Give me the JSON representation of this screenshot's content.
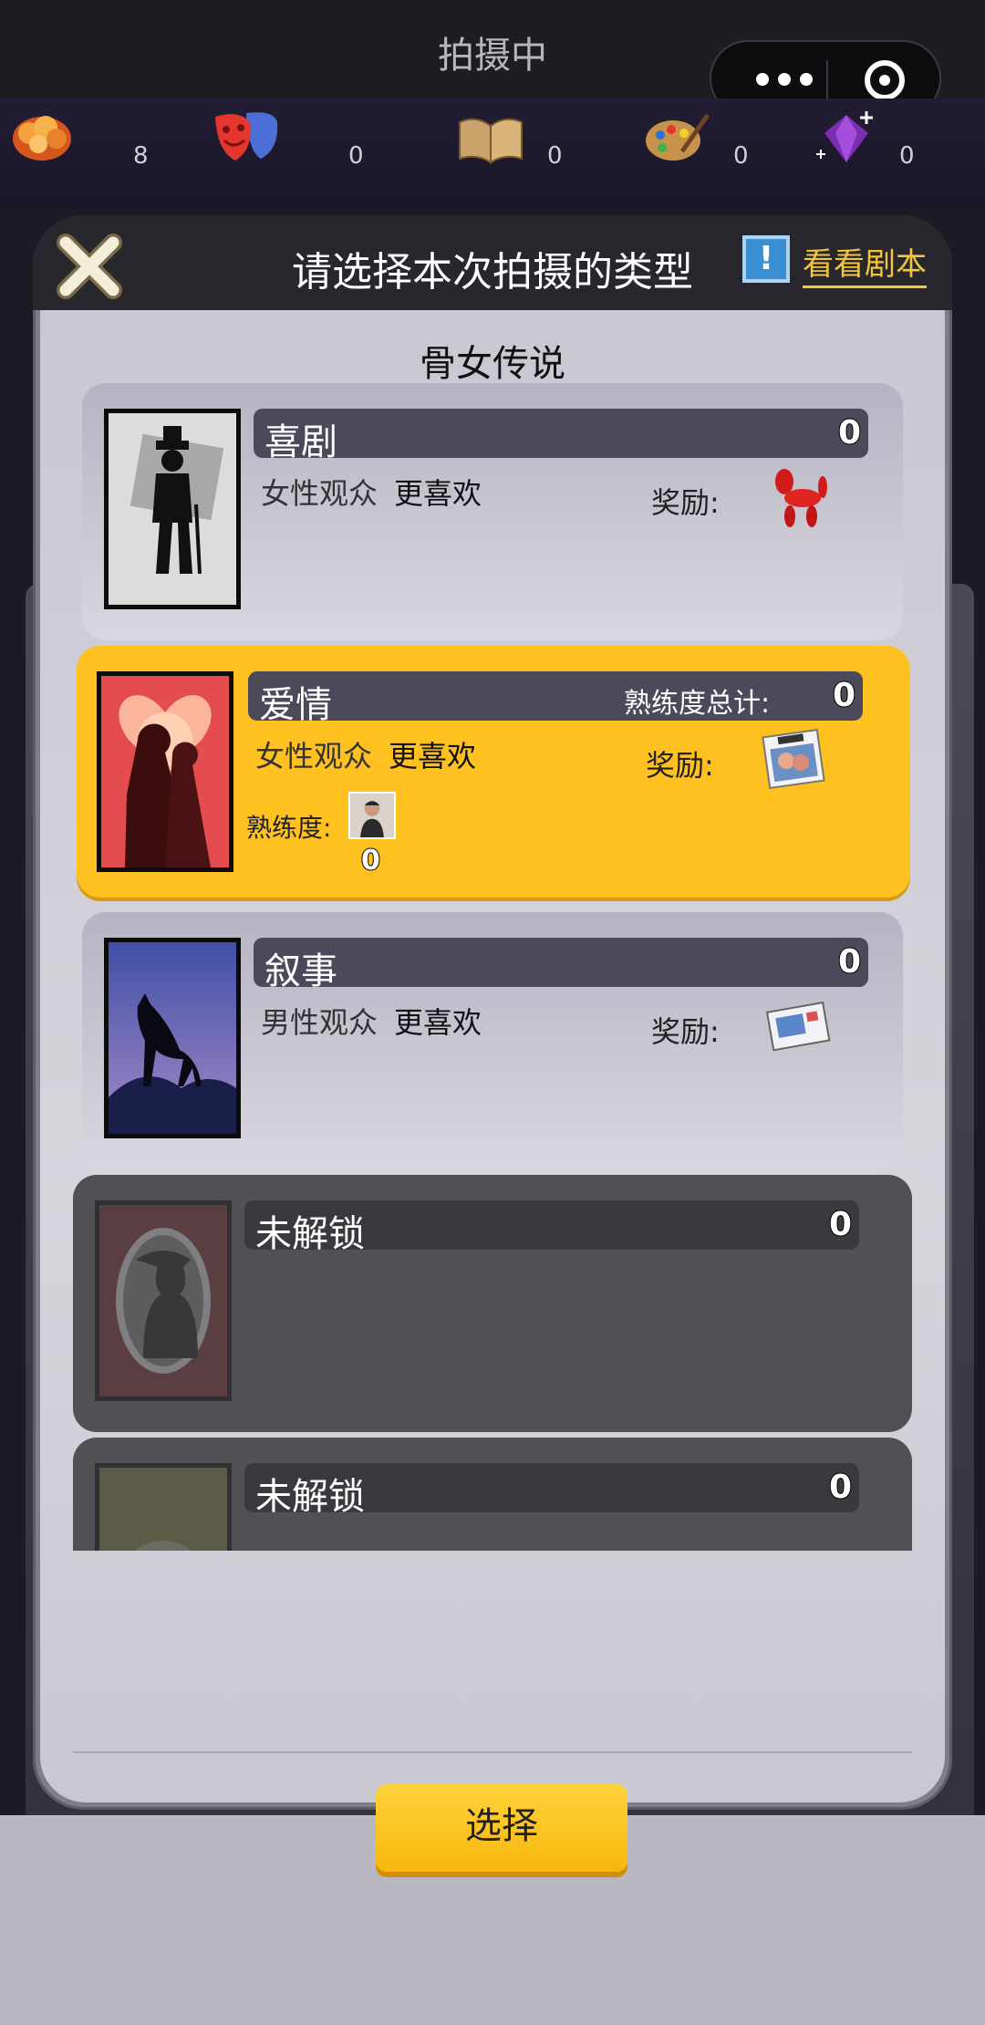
{
  "window": {
    "title": "拍摄中"
  },
  "resources": [
    {
      "icon": "popcorn-icon",
      "count": "8"
    },
    {
      "icon": "theater-masks-icon",
      "count": "0"
    },
    {
      "icon": "book-icon",
      "count": "0"
    },
    {
      "icon": "palette-icon",
      "count": "0"
    },
    {
      "icon": "gem-icon",
      "count": "0"
    }
  ],
  "modal": {
    "title": "请选择本次拍摄的类型",
    "script_link": "看看剧本",
    "story_title": "骨女传说",
    "select_label": "选择"
  },
  "genres": [
    {
      "name": "喜剧",
      "count": "0",
      "audience": "女性观众",
      "prefers": "更喜欢",
      "reward_label": "奖励:",
      "reward_icon": "balloon-dog-icon",
      "state": "normal"
    },
    {
      "name": "爱情",
      "count": "0",
      "total_label": "熟练度总计:",
      "audience": "女性观众",
      "prefers": "更喜欢",
      "reward_label": "奖励:",
      "reward_icon": "calendar-photo-icon",
      "proficiency_label": "熟练度:",
      "proficiency_value": "0",
      "state": "selected"
    },
    {
      "name": "叙事",
      "count": "0",
      "audience": "男性观众",
      "prefers": "更喜欢",
      "reward_label": "奖励:",
      "reward_icon": "postcard-icon",
      "state": "normal"
    },
    {
      "name": "未解锁",
      "count": "0",
      "state": "locked"
    },
    {
      "name": "未解锁",
      "count": "0",
      "state": "locked"
    }
  ],
  "colors": {
    "accent": "#fec11f",
    "link": "#f3c53b",
    "header": "#27272d"
  }
}
